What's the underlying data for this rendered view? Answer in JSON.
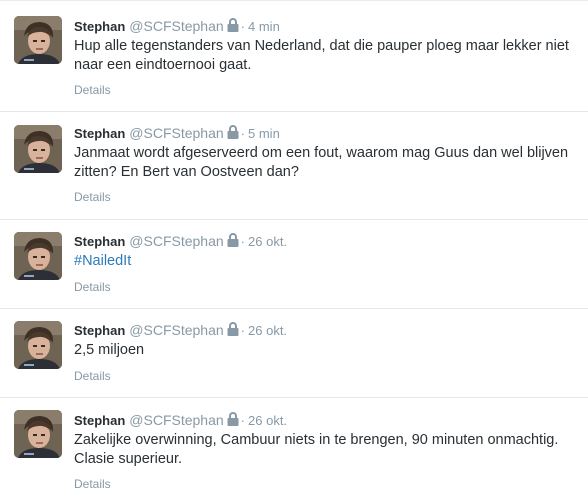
{
  "tweets": [
    {
      "name": "Stephan",
      "handle": "@SCFStephan",
      "separator": "·",
      "time": "4 min",
      "text": "Hup alle tegenstanders van Nederland, dat die pauper ploeg maar lekker niet naar een eindtoernooi gaat.",
      "details": "Details"
    },
    {
      "name": "Stephan",
      "handle": "@SCFStephan",
      "separator": "·",
      "time": "5 min",
      "text": "Janmaat wordt afgeserveerd om een fout, waarom mag Guus dan wel blijven zitten? En Bert van Oostveen dan?",
      "details": "Details"
    },
    {
      "name": "Stephan",
      "handle": "@SCFStephan",
      "separator": "·",
      "time": "26 okt.",
      "text": "#NailedIt",
      "details": "Details"
    },
    {
      "name": "Stephan",
      "handle": "@SCFStephan",
      "separator": "·",
      "time": "26 okt.",
      "text": "2,5 miljoen",
      "details": "Details"
    },
    {
      "name": "Stephan",
      "handle": "@SCFStephan",
      "separator": "·",
      "time": "26 okt.",
      "text": "Zakelijke overwinning, Cambuur niets in te brengen, 90 minuten onmachtig. Clasie superieur.",
      "details": "Details"
    }
  ],
  "icons": {
    "lock": "lock-icon",
    "avatar": "avatar"
  },
  "colors": {
    "name": "#292f33",
    "meta": "#8899a6",
    "hashtag": "#2b7bb9",
    "divider": "#e1e8ed"
  }
}
